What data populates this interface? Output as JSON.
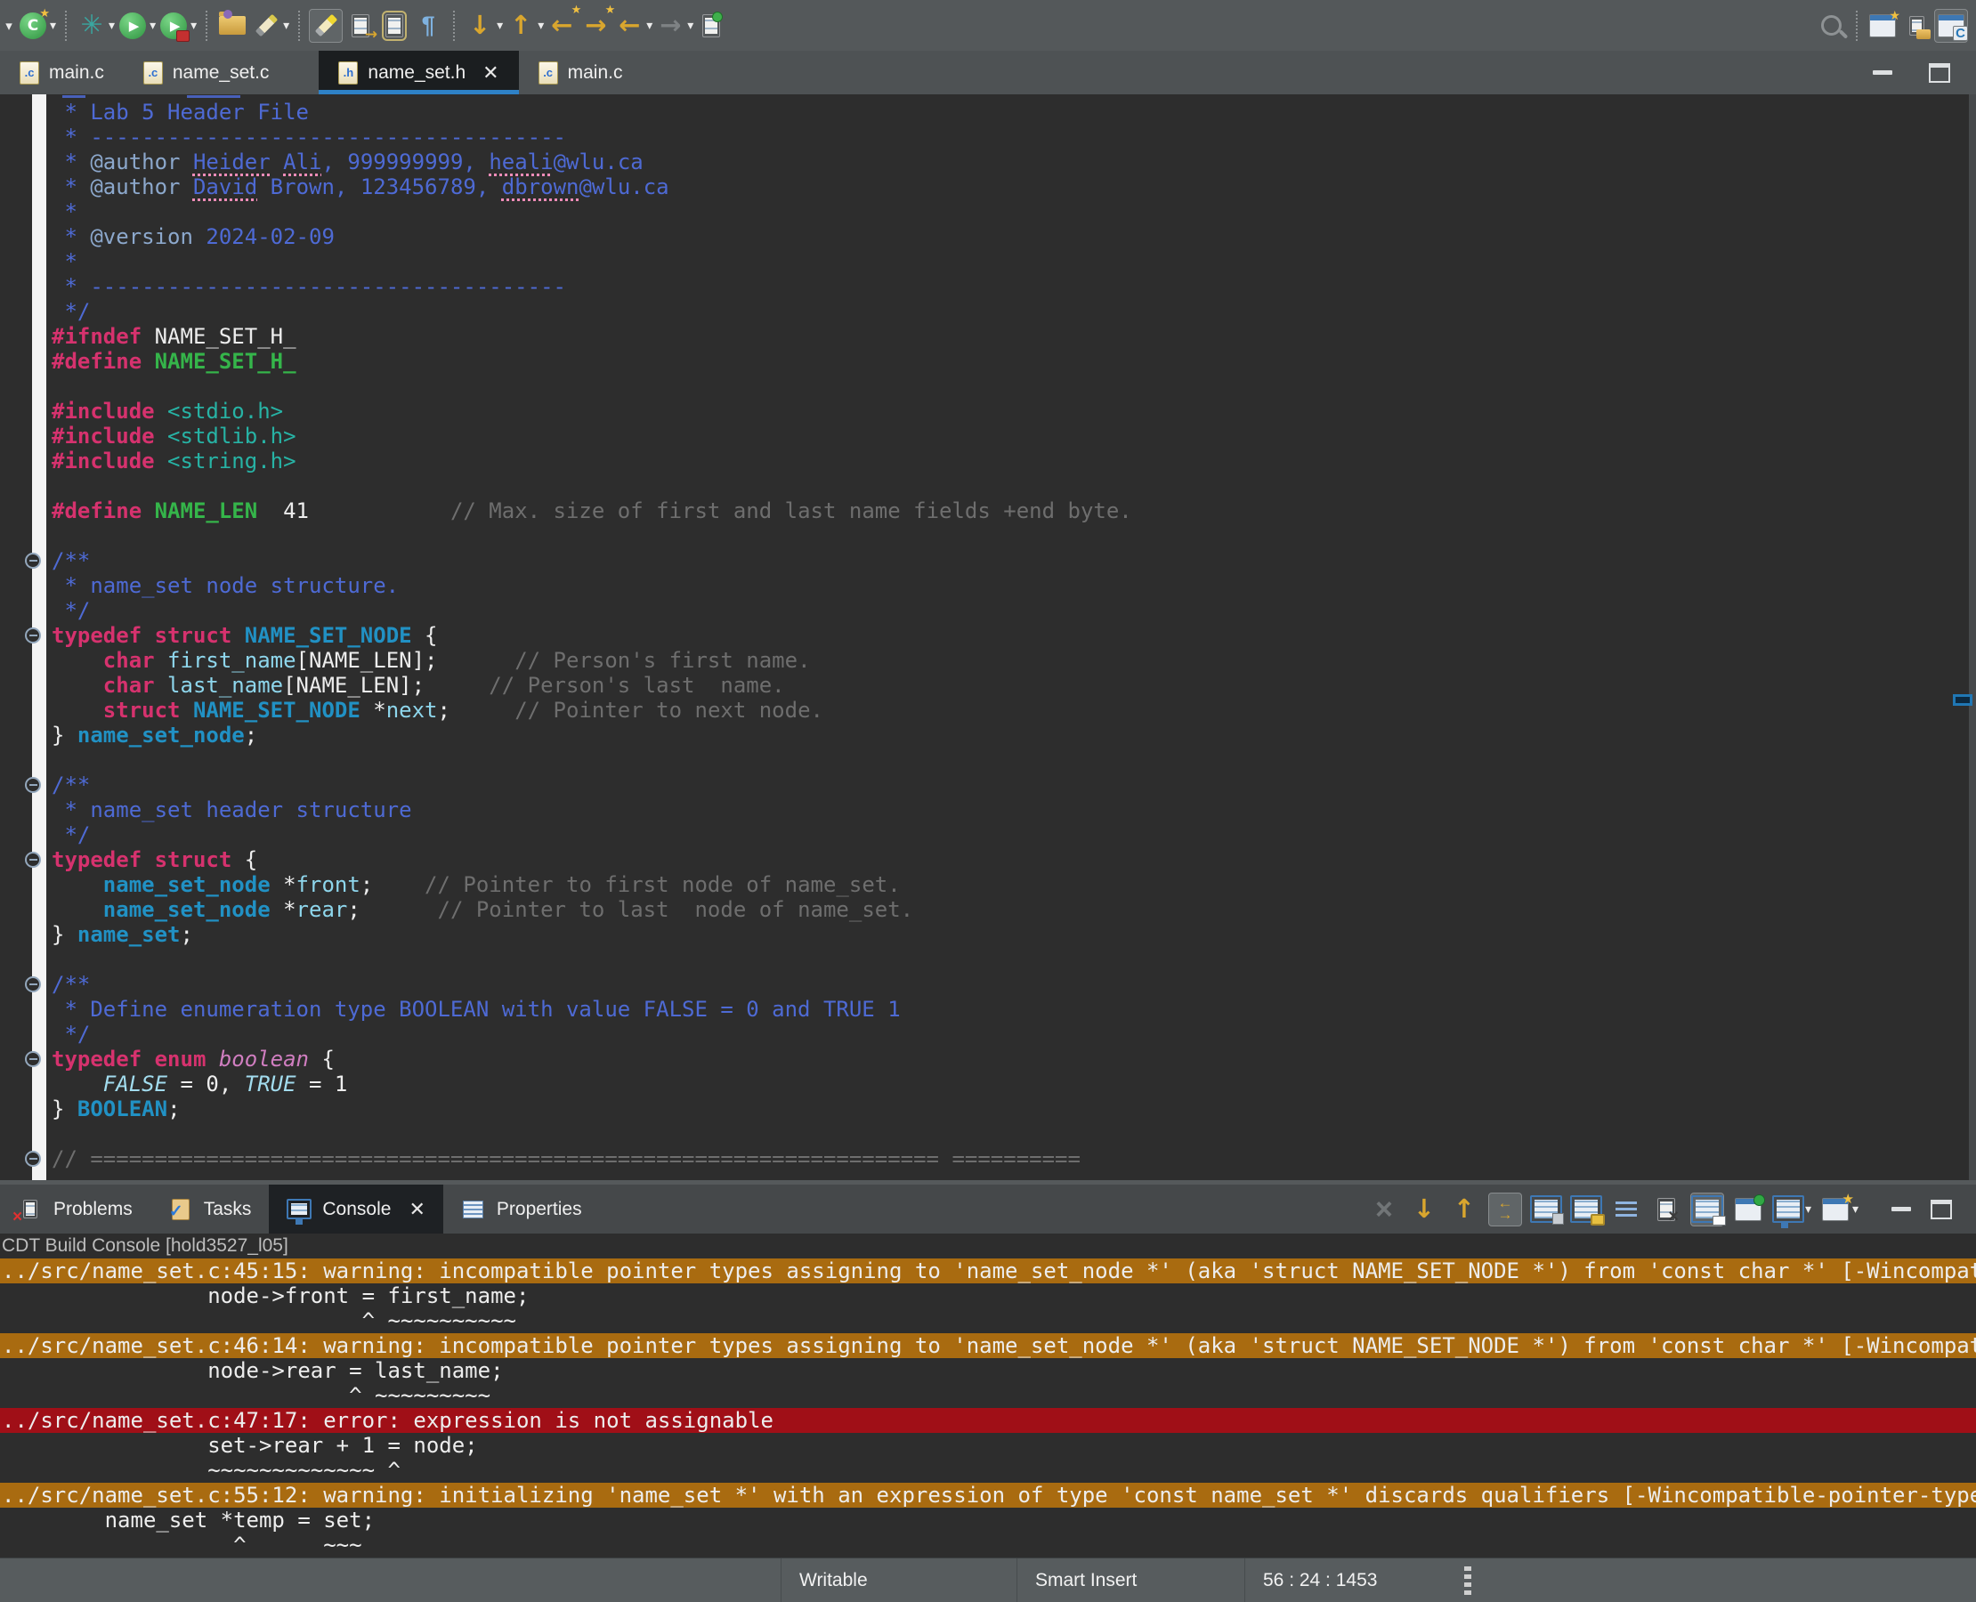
{
  "colors": {
    "accent_blue": "#2E81C6",
    "warning_bg": "#A96B10",
    "error_bg": "#A00F17",
    "editor_bg": "#2D2D2D",
    "chrome_bg": "#54585A",
    "status_bg": "#575C5E"
  },
  "toolbar": {
    "left_items": [
      {
        "t": "icon",
        "name": "overflow-chevron-icon",
        "kind": "chevron"
      },
      {
        "t": "icon",
        "name": "new-c-project-icon",
        "kind": "newwiz",
        "dropdown": true
      },
      {
        "t": "sep"
      },
      {
        "t": "icon",
        "name": "debug-icon",
        "kind": "debug",
        "dropdown": true
      },
      {
        "t": "icon",
        "name": "run-icon",
        "kind": "run",
        "dropdown": true
      },
      {
        "t": "icon",
        "name": "profile-icon",
        "kind": "profile",
        "dropdown": true
      },
      {
        "t": "sep"
      },
      {
        "t": "icon",
        "name": "open-folder-icon",
        "kind": "folder"
      },
      {
        "t": "icon",
        "name": "marker-pen-icon",
        "kind": "pen",
        "dropdown": true
      },
      {
        "t": "sep"
      },
      {
        "t": "icon",
        "name": "mark-occurrences-toggle-icon",
        "kind": "highlighter",
        "pressed": true
      },
      {
        "t": "icon",
        "name": "next-edit-icon",
        "kind": "pagearrow"
      },
      {
        "t": "icon",
        "name": "show-source-icon",
        "kind": "framedpage"
      },
      {
        "t": "icon",
        "name": "show-whitespace-icon",
        "kind": "pilcrow"
      },
      {
        "t": "sep"
      },
      {
        "t": "icon",
        "name": "next-annotation-icon",
        "kind": "down",
        "dropdown": true
      },
      {
        "t": "icon",
        "name": "previous-annotation-icon",
        "kind": "up",
        "dropdown": true
      },
      {
        "t": "icon",
        "name": "back-jump-icon",
        "kind": "backstar"
      },
      {
        "t": "icon",
        "name": "forward-jump-icon",
        "kind": "fwdstar"
      },
      {
        "t": "icon",
        "name": "back-history-icon",
        "kind": "back",
        "dropdown": true
      },
      {
        "t": "icon",
        "name": "forward-history-icon",
        "kind": "fwd",
        "disabled": true,
        "dropdown": true
      },
      {
        "t": "icon",
        "name": "last-edit-location-icon",
        "kind": "newpage"
      }
    ],
    "right_items": [
      {
        "t": "icon",
        "name": "search-icon",
        "kind": "search"
      },
      {
        "t": "sep"
      },
      {
        "t": "icon",
        "name": "open-perspective-icon",
        "kind": "perspective"
      },
      {
        "t": "icon",
        "name": "open-resource-icon",
        "kind": "copydocs"
      },
      {
        "t": "icon",
        "name": "c-cpp-perspective-icon",
        "kind": "cpersp",
        "pressed": true
      }
    ]
  },
  "editor_tabs": [
    {
      "label": "main.c",
      "file_letter": ".c",
      "active": false
    },
    {
      "label": "name_set.c",
      "file_letter": ".c",
      "active": false
    },
    {
      "label": "name_set.h",
      "file_letter": ".h",
      "active": true,
      "closable": true,
      "gap_before": 34
    },
    {
      "label": "main.c",
      "file_letter": ".c",
      "active": false
    }
  ],
  "window_controls": [
    {
      "name": "minimize-icon",
      "kind": "min"
    },
    {
      "name": "maximize-icon",
      "kind": "max"
    }
  ],
  "editor": {
    "fold_lines": [
      18,
      21,
      27,
      30,
      35,
      38,
      42
    ],
    "code_lines": [
      [
        [
          "cmt",
          " * Lab 5 Header File"
        ]
      ],
      [
        [
          "cmt",
          " * -------------------------------------"
        ]
      ],
      [
        [
          "cmt",
          " * "
        ],
        [
          "tag",
          "@author"
        ],
        [
          "cmt",
          " "
        ],
        [
          "mis",
          "Heider"
        ],
        [
          "cmt",
          " "
        ],
        [
          "mis",
          "Ali"
        ],
        [
          "cmt",
          ", 999999999, "
        ],
        [
          "mis",
          "heali"
        ],
        [
          "cmt",
          "@wlu.ca"
        ]
      ],
      [
        [
          "cmt",
          " * "
        ],
        [
          "tag",
          "@author"
        ],
        [
          "cmt",
          " "
        ],
        [
          "mis",
          "David"
        ],
        [
          "cmt",
          " Brown, 123456789, "
        ],
        [
          "mis",
          "dbrown"
        ],
        [
          "cmt",
          "@wlu.ca"
        ]
      ],
      [
        [
          "cmt",
          " *"
        ]
      ],
      [
        [
          "cmt",
          " * "
        ],
        [
          "tag",
          "@version"
        ],
        [
          "cmt",
          " 2024-02-09"
        ]
      ],
      [
        [
          "cmt",
          " *"
        ]
      ],
      [
        [
          "cmt",
          " * -------------------------------------"
        ]
      ],
      [
        [
          "cmt",
          " */"
        ]
      ],
      [
        [
          "pp",
          "#ifndef"
        ],
        [
          "w",
          " NAME_SET_H_"
        ]
      ],
      [
        [
          "pp",
          "#define"
        ],
        [
          "mac",
          " NAME_SET_H_"
        ]
      ],
      [],
      [
        [
          "pp",
          "#include"
        ],
        [
          "w",
          " "
        ],
        [
          "inc",
          "<stdio.h>"
        ]
      ],
      [
        [
          "pp",
          "#include"
        ],
        [
          "w",
          " "
        ],
        [
          "inc",
          "<stdlib.h>"
        ]
      ],
      [
        [
          "pp",
          "#include"
        ],
        [
          "w",
          " "
        ],
        [
          "inc",
          "<string.h>"
        ]
      ],
      [],
      [
        [
          "pp",
          "#define"
        ],
        [
          "mac",
          " NAME_LEN"
        ],
        [
          "w",
          "  41"
        ],
        [
          "c",
          "           // Max. size of first and last name fields +end byte."
        ]
      ],
      [],
      [
        [
          "cmt",
          "/**"
        ]
      ],
      [
        [
          "cmt",
          " * name_set node structure."
        ]
      ],
      [
        [
          "cmt",
          " */"
        ]
      ],
      [
        [
          "kw",
          "typedef"
        ],
        [
          "w",
          " "
        ],
        [
          "kw",
          "struct"
        ],
        [
          "w",
          " "
        ],
        [
          "type",
          "NAME_SET_NODE"
        ],
        [
          "w",
          " {"
        ]
      ],
      [
        [
          "w",
          "    "
        ],
        [
          "kw",
          "char"
        ],
        [
          "w",
          " "
        ],
        [
          "mem",
          "first_name"
        ],
        [
          "w",
          "[NAME_LEN];"
        ],
        [
          "c",
          "      // Person's first name."
        ]
      ],
      [
        [
          "w",
          "    "
        ],
        [
          "kw",
          "char"
        ],
        [
          "w",
          " "
        ],
        [
          "mem",
          "last_name"
        ],
        [
          "w",
          "[NAME_LEN];"
        ],
        [
          "c",
          "     // Person's last  name."
        ]
      ],
      [
        [
          "w",
          "    "
        ],
        [
          "kw",
          "struct"
        ],
        [
          "w",
          " "
        ],
        [
          "type",
          "NAME_SET_NODE"
        ],
        [
          "w",
          " *"
        ],
        [
          "mem",
          "next"
        ],
        [
          "w",
          ";"
        ],
        [
          "c",
          "     // Pointer to next node."
        ]
      ],
      [
        [
          "w",
          "} "
        ],
        [
          "type",
          "name_set_node"
        ],
        [
          "w",
          ";"
        ]
      ],
      [],
      [
        [
          "cmt",
          "/**"
        ]
      ],
      [
        [
          "cmt",
          " * name_set header structure"
        ]
      ],
      [
        [
          "cmt",
          " */"
        ]
      ],
      [
        [
          "kw",
          "typedef"
        ],
        [
          "w",
          " "
        ],
        [
          "kw",
          "struct"
        ],
        [
          "w",
          " {"
        ]
      ],
      [
        [
          "w",
          "    "
        ],
        [
          "type",
          "name_set_node"
        ],
        [
          "w",
          " *"
        ],
        [
          "mem",
          "front"
        ],
        [
          "w",
          ";"
        ],
        [
          "c",
          "    // Pointer to first node of name_set."
        ]
      ],
      [
        [
          "w",
          "    "
        ],
        [
          "type",
          "name_set_node"
        ],
        [
          "w",
          " *"
        ],
        [
          "mem",
          "rear"
        ],
        [
          "w",
          ";"
        ],
        [
          "c",
          "      // Pointer to last  node of name_set."
        ]
      ],
      [
        [
          "w",
          "} "
        ],
        [
          "type",
          "name_set"
        ],
        [
          "w",
          ";"
        ]
      ],
      [],
      [
        [
          "cmt",
          "/**"
        ]
      ],
      [
        [
          "cmt",
          " * Define enumeration type BOOLEAN with value FALSE = 0 and TRUE 1"
        ]
      ],
      [
        [
          "cmt",
          " */"
        ]
      ],
      [
        [
          "kw",
          "typedef"
        ],
        [
          "w",
          " "
        ],
        [
          "kw",
          "enum"
        ],
        [
          "w",
          " "
        ],
        [
          "en",
          "boolean"
        ],
        [
          "w",
          " {"
        ]
      ],
      [
        [
          "w",
          "    "
        ],
        [
          "ec",
          "FALSE"
        ],
        [
          "w",
          " = 0, "
        ],
        [
          "ec",
          "TRUE"
        ],
        [
          "w",
          " = 1"
        ]
      ],
      [
        [
          "w",
          "} "
        ],
        [
          "type",
          "BOOLEAN"
        ],
        [
          "w",
          ";"
        ]
      ],
      [],
      [
        [
          "c",
          "// ================================================================== =========="
        ]
      ]
    ]
  },
  "panel": {
    "tabs": [
      {
        "label": "Problems",
        "icon": "problems-icon",
        "kind": "problems"
      },
      {
        "label": "Tasks",
        "icon": "tasks-icon",
        "kind": "tasks"
      },
      {
        "label": "Console",
        "icon": "console-icon",
        "kind": "console-tab",
        "active": true,
        "closable": true
      },
      {
        "label": "Properties",
        "icon": "properties-icon",
        "kind": "properties"
      }
    ],
    "toolbar_items": [
      {
        "t": "icon",
        "name": "close-console-icon",
        "kind": "close",
        "disabled": true
      },
      {
        "t": "icon",
        "name": "next-error-icon",
        "kind": "down"
      },
      {
        "t": "icon",
        "name": "previous-error-icon",
        "kind": "up"
      },
      {
        "t": "icon",
        "name": "show-error-in-editor-toggle-icon",
        "kind": "swap",
        "pressed": true
      },
      {
        "t": "icon",
        "name": "save-console-icon",
        "kind": "savepanel"
      },
      {
        "t": "icon",
        "name": "scroll-lock-icon",
        "kind": "lockpanel"
      },
      {
        "t": "icon",
        "name": "word-wrap-icon",
        "kind": "wrap"
      },
      {
        "t": "icon",
        "name": "clear-console-icon",
        "kind": "clear"
      },
      {
        "t": "icon",
        "name": "pin-console-icon",
        "kind": "pinconsole",
        "pressed": true
      },
      {
        "t": "icon",
        "name": "link-console-icon",
        "kind": "greenpin"
      },
      {
        "t": "icon",
        "name": "display-selected-console-icon",
        "kind": "monitor",
        "dropdown": true
      },
      {
        "t": "icon",
        "name": "open-console-icon",
        "kind": "newconsole",
        "dropdown": true
      },
      {
        "t": "gap"
      },
      {
        "t": "icon",
        "name": "minimize-panel-icon",
        "kind": "min"
      },
      {
        "t": "icon",
        "name": "maximize-panel-icon",
        "kind": "max"
      }
    ],
    "console_label": "CDT Build Console [hold3527_l05]",
    "console_lines": [
      {
        "bg": "warning",
        "text": "../src/name_set.c:45:15: warning: incompatible pointer types assigning to 'name_set_node *' (aka 'struct NAME_SET_NODE *') from 'const char *' [-Wincompat"
      },
      {
        "bg": "plain",
        "text": "                node->front = first_name;"
      },
      {
        "bg": "plain",
        "text": "                            ^ ~~~~~~~~~~"
      },
      {
        "bg": "warning",
        "text": "../src/name_set.c:46:14: warning: incompatible pointer types assigning to 'name_set_node *' (aka 'struct NAME_SET_NODE *') from 'const char *' [-Wincompat"
      },
      {
        "bg": "plain",
        "text": "                node->rear = last_name;"
      },
      {
        "bg": "plain",
        "text": "                           ^ ~~~~~~~~~"
      },
      {
        "bg": "error",
        "text": "../src/name_set.c:47:17: error: expression is not assignable"
      },
      {
        "bg": "plain",
        "text": "                set->rear + 1 = node;"
      },
      {
        "bg": "plain",
        "text": "                ~~~~~~~~~~~~~ ^"
      },
      {
        "bg": "warning",
        "text": "../src/name_set.c:55:12: warning: initializing 'name_set *' with an expression of type 'const name_set *' discards qualifiers [-Wincompatible-pointer-type"
      },
      {
        "bg": "plain",
        "text": "        name_set *temp = set;"
      },
      {
        "bg": "plain",
        "text": "                  ^      ~~~"
      }
    ]
  },
  "statusbar": {
    "writable": "Writable",
    "insert_mode": "Smart Insert",
    "position": "56 : 24 : 1453"
  }
}
